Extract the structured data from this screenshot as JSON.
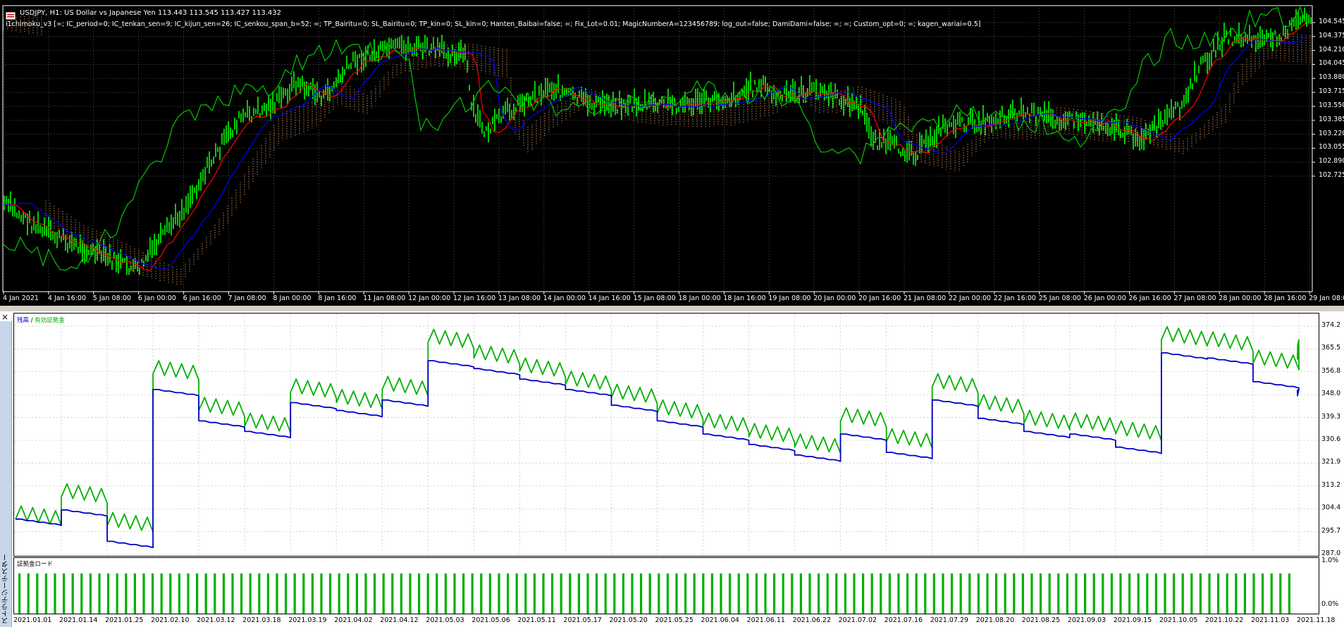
{
  "top_chart": {
    "title": "USDJPY, H1:  US Dollar vs Japanese Yen  113.443 113.545 113.427 113.432",
    "params": "i1chimoku_v3 [=; IC_period=0; IC_tenkan_sen=9; IC_kijun_sen=26; IC_senkou_span_b=52; =; TP_Bairitu=0; SL_Bairitu=0; TP_kin=0; SL_kin=0; Hanten_Baibai=false; =; Fix_Lot=0.01; MagicNumberA=123456789; log_out=false; DamiDami=false; =; =; Custom_opt=0; =; kagen_wariai=0.5]",
    "price_labels": [
      "104.545",
      "104.375",
      "104.210",
      "104.045",
      "103.880",
      "103.715",
      "103.550",
      "103.385",
      "103.220",
      "103.055",
      "102.890",
      "102.725"
    ],
    "time_labels": [
      "4 Jan 2021",
      "4 Jan 16:00",
      "5 Jan 08:00",
      "6 Jan 00:00",
      "6 Jan 16:00",
      "7 Jan 08:00",
      "8 Jan 00:00",
      "8 Jan 16:00",
      "11 Jan 08:00",
      "12 Jan 00:00",
      "12 Jan 16:00",
      "13 Jan 08:00",
      "14 Jan 00:00",
      "14 Jan 16:00",
      "15 Jan 08:00",
      "18 Jan 00:00",
      "18 Jan 16:00",
      "19 Jan 08:00",
      "20 Jan 00:00",
      "20 Jan 16:00",
      "21 Jan 08:00",
      "22 Jan 00:00",
      "22 Jan 16:00",
      "25 Jan 08:00",
      "26 Jan 00:00",
      "26 Jan 16:00",
      "27 Jan 08:00",
      "28 Jan 00:00",
      "28 Jan 16:00",
      "29 Jan 08:00"
    ],
    "colors": {
      "background": "#000000",
      "candles": "#00ff00",
      "tenkan": "#ff0000",
      "kijun": "#0000ff",
      "chikou": "#00c800",
      "cloud": "#f0a060"
    }
  },
  "tester": {
    "close_glyph": "×",
    "side_tab_label": "ストラテジーテスター",
    "legend_balance": "残高",
    "legend_sep": " / ",
    "legend_equity": "有効証拠金",
    "load_label": "証拠金ロード",
    "y_labels": [
      "374.2",
      "365.5",
      "356.8",
      "348.0",
      "339.3",
      "330.6",
      "321.9",
      "313.2",
      "304.4",
      "295.7",
      "287.0"
    ],
    "load_labels": [
      "1.0%",
      "0.0%"
    ],
    "date_labels": [
      "2021.01.01",
      "2021.01.14",
      "2021.01.25",
      "2021.02.10",
      "2021.03.12",
      "2021.03.18",
      "2021.03.19",
      "2021.04.02",
      "2021.04.12",
      "2021.05.03",
      "2021.05.06",
      "2021.05.11",
      "2021.05.17",
      "2021.05.20",
      "2021.05.25",
      "2021.06.04",
      "2021.06.11",
      "2021.06.22",
      "2021.07.02",
      "2021.07.16",
      "2021.07.29",
      "2021.08.20",
      "2021.08.25",
      "2021.09.03",
      "2021.09.15",
      "2021.10.05",
      "2021.10.22",
      "2021.11.03",
      "2021.11.18"
    ],
    "colors": {
      "balance": "#0000c8",
      "equity": "#00b000",
      "load_bar": "#00b000"
    },
    "chart_data": {
      "type": "line",
      "series": [
        {
          "name": "残高",
          "x": [
            "2021.01.01",
            "2021.01.14",
            "2021.01.25",
            "2021.02.10",
            "2021.03.12",
            "2021.03.18",
            "2021.03.19",
            "2021.04.02",
            "2021.04.12",
            "2021.05.03",
            "2021.05.06",
            "2021.05.11",
            "2021.05.17",
            "2021.05.20",
            "2021.05.25",
            "2021.06.04",
            "2021.06.11",
            "2021.06.22",
            "2021.07.02",
            "2021.07.16",
            "2021.07.29",
            "2021.08.20",
            "2021.08.25",
            "2021.09.03",
            "2021.09.15",
            "2021.10.05",
            "2021.10.22",
            "2021.11.03",
            "2021.11.18"
          ],
          "values": [
            300.5,
            304.0,
            292.0,
            350.0,
            338.0,
            334.0,
            345.0,
            342.0,
            346.0,
            361.0,
            358.0,
            354.0,
            350.0,
            344.0,
            338.0,
            333.0,
            329.0,
            325.0,
            333.0,
            326.0,
            346.0,
            339.0,
            334.0,
            333.0,
            328.0,
            364.0,
            362.0,
            353.0,
            350.0
          ]
        },
        {
          "name": "有効証拠金",
          "x": [
            "2021.01.01",
            "2021.01.14",
            "2021.01.25",
            "2021.02.10",
            "2021.03.12",
            "2021.03.18",
            "2021.03.19",
            "2021.04.02",
            "2021.04.12",
            "2021.05.03",
            "2021.05.06",
            "2021.05.11",
            "2021.05.17",
            "2021.05.20",
            "2021.05.25",
            "2021.06.04",
            "2021.06.11",
            "2021.06.22",
            "2021.07.02",
            "2021.07.16",
            "2021.07.29",
            "2021.08.20",
            "2021.08.25",
            "2021.09.03",
            "2021.09.15",
            "2021.10.05",
            "2021.10.22",
            "2021.11.03",
            "2021.11.18"
          ],
          "values": [
            300.5,
            309.0,
            298.0,
            356.0,
            342.0,
            336.0,
            349.0,
            345.0,
            350.0,
            368.0,
            362.0,
            357.0,
            352.0,
            347.0,
            341.0,
            336.0,
            332.0,
            328.0,
            338.0,
            330.0,
            351.0,
            343.0,
            337.0,
            336.0,
            333.0,
            369.0,
            367.0,
            360.0,
            364.0
          ]
        }
      ],
      "ylim": [
        287.0,
        374.2
      ],
      "grid": true
    }
  }
}
